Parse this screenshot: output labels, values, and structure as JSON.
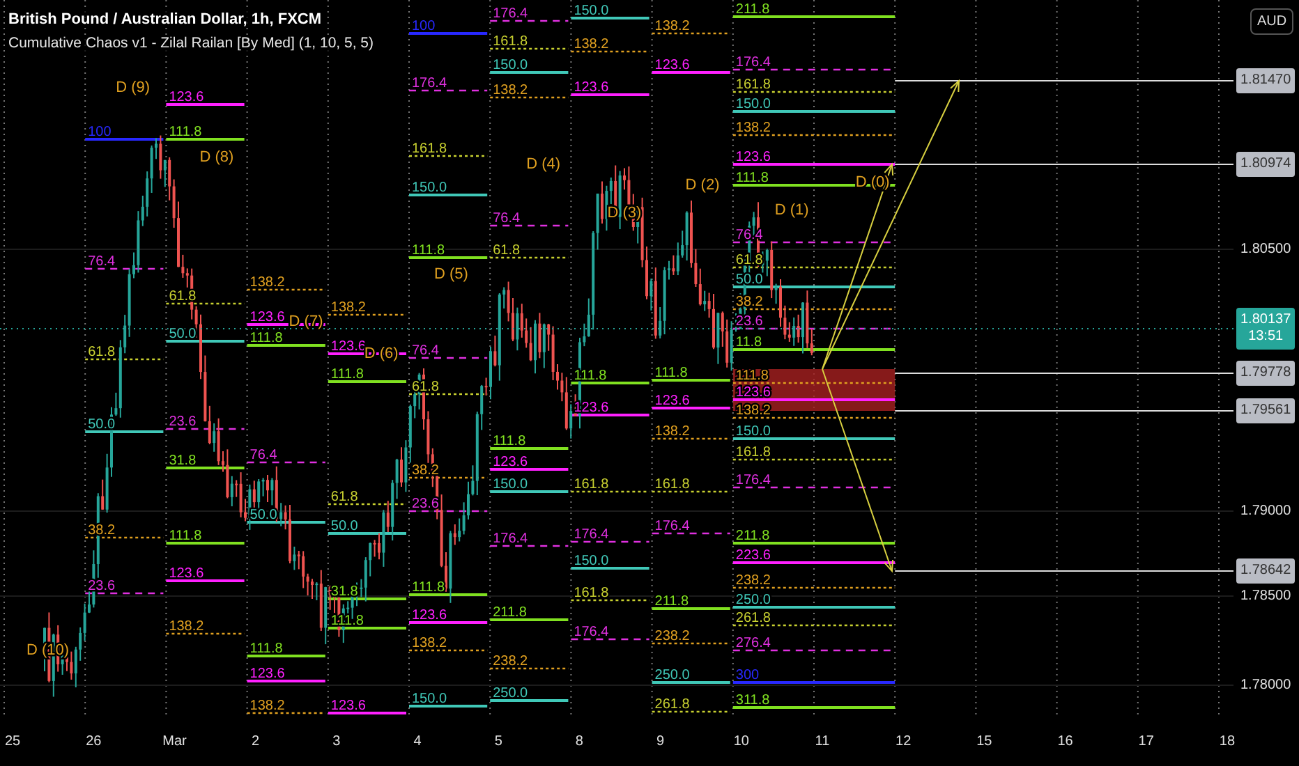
{
  "legend": {
    "title": "British Pound / Australian Dollar, 1h, FXCM",
    "indicator": "Cumulative Chaos v1 - Zilal Railan [By Med] (1, 10, 5, 5)"
  },
  "currency": "AUD",
  "fib_columns": [
    {
      "waves": [
        {
          "label": "D (10)"
        }
      ]
    },
    {
      "levels": [
        {
          "label": "100",
          "color": "#2828ff",
          "kind": "solid"
        },
        {
          "label": "76.4",
          "color": "#e030e0",
          "kind": "dashed"
        },
        {
          "label": "61.8",
          "color": "#c8d030",
          "kind": "dotted"
        },
        {
          "label": "50.0",
          "color": "#40c8b8",
          "kind": "solid"
        },
        {
          "label": "38.2",
          "color": "#e0a020",
          "kind": "dotted"
        },
        {
          "label": "23.6",
          "color": "#e030e0",
          "kind": "dashed"
        }
      ],
      "waves": [
        {
          "label": "D (9)"
        }
      ]
    },
    {
      "levels": [
        {
          "label": "123.6",
          "color": "#ff20ff",
          "kind": "solid"
        },
        {
          "label": "111.8",
          "color": "#80e020",
          "kind": "solid"
        },
        {
          "label": "61.8",
          "color": "#c8d030",
          "kind": "dotted"
        },
        {
          "label": "50.0",
          "color": "#40c8b8",
          "kind": "solid"
        },
        {
          "label": "23.6",
          "color": "#e030e0",
          "kind": "dashed"
        },
        {
          "label": "31.8",
          "color": "#80e020",
          "kind": "solid"
        },
        {
          "label": "111.8",
          "color": "#80e020",
          "kind": "solid"
        },
        {
          "label": "123.6",
          "color": "#ff20ff",
          "kind": "solid"
        },
        {
          "label": "138.2",
          "color": "#e0a020",
          "kind": "dotted"
        }
      ],
      "waves": [
        {
          "label": "D (8)"
        }
      ]
    },
    {
      "levels": [
        {
          "label": "138.2",
          "color": "#e0a020",
          "kind": "dotted"
        },
        {
          "label": "123.6",
          "color": "#ff20ff",
          "kind": "solid"
        },
        {
          "label": "111.8",
          "color": "#80e020",
          "kind": "solid"
        },
        {
          "label": "76.4",
          "color": "#e030e0",
          "kind": "dashed"
        },
        {
          "label": "50.0",
          "color": "#40c8b8",
          "kind": "solid"
        },
        {
          "label": "111.8",
          "color": "#80e020",
          "kind": "solid"
        },
        {
          "label": "123.6",
          "color": "#ff20ff",
          "kind": "solid"
        },
        {
          "label": "138.2",
          "color": "#e0a020",
          "kind": "dotted"
        }
      ],
      "waves": [
        {
          "label": "D (7)"
        }
      ]
    },
    {
      "levels": [
        {
          "label": "138.2",
          "color": "#e0a020",
          "kind": "dotted"
        },
        {
          "label": "123.6",
          "color": "#ff20ff",
          "kind": "solid"
        },
        {
          "label": "111.8",
          "color": "#80e020",
          "kind": "solid"
        },
        {
          "label": "61.8",
          "color": "#c8d030",
          "kind": "dotted"
        },
        {
          "label": "50.0",
          "color": "#40c8b8",
          "kind": "solid"
        },
        {
          "label": "31.8",
          "color": "#80e020",
          "kind": "solid"
        },
        {
          "label": "111.8",
          "color": "#80e020",
          "kind": "solid"
        },
        {
          "label": "123.6",
          "color": "#ff20ff",
          "kind": "solid"
        }
      ],
      "waves": [
        {
          "label": "D (6)"
        }
      ]
    },
    {
      "levels": [
        {
          "label": "100",
          "color": "#2828ff",
          "kind": "solid"
        },
        {
          "label": "176.4",
          "color": "#e030e0",
          "kind": "dashed"
        },
        {
          "label": "161.8",
          "color": "#c8d030",
          "kind": "dotted"
        },
        {
          "label": "150.0",
          "color": "#40c8b8",
          "kind": "solid"
        },
        {
          "label": "111.8",
          "color": "#80e020",
          "kind": "solid"
        },
        {
          "label": "76.4",
          "color": "#e030e0",
          "kind": "dashed"
        },
        {
          "label": "61.8",
          "color": "#c8d030",
          "kind": "dotted"
        },
        {
          "label": "38.2",
          "color": "#e0a020",
          "kind": "dotted"
        },
        {
          "label": "23.6",
          "color": "#e030e0",
          "kind": "dashed"
        },
        {
          "label": "111.8",
          "color": "#80e020",
          "kind": "solid"
        },
        {
          "label": "123.6",
          "color": "#ff20ff",
          "kind": "solid"
        },
        {
          "label": "138.2",
          "color": "#e0a020",
          "kind": "dotted"
        },
        {
          "label": "150.0",
          "color": "#40c8b8",
          "kind": "solid"
        }
      ],
      "waves": [
        {
          "label": "D (5)"
        }
      ]
    },
    {
      "levels": [
        {
          "label": "176.4",
          "color": "#e030e0",
          "kind": "dashed"
        },
        {
          "label": "161.8",
          "color": "#c8d030",
          "kind": "dotted"
        },
        {
          "label": "150.0",
          "color": "#40c8b8",
          "kind": "solid"
        },
        {
          "label": "138.2",
          "color": "#e0a020",
          "kind": "dotted"
        },
        {
          "label": "76.4",
          "color": "#e030e0",
          "kind": "dashed"
        },
        {
          "label": "61.8",
          "color": "#c8d030",
          "kind": "dotted"
        },
        {
          "label": "111.8",
          "color": "#80e020",
          "kind": "solid"
        },
        {
          "label": "123.6",
          "color": "#ff20ff",
          "kind": "solid"
        },
        {
          "label": "150.0",
          "color": "#40c8b8",
          "kind": "solid"
        },
        {
          "label": "176.4",
          "color": "#e030e0",
          "kind": "dashed"
        },
        {
          "label": "211.8",
          "color": "#80e020",
          "kind": "solid"
        },
        {
          "label": "238.2",
          "color": "#e0a020",
          "kind": "dotted"
        },
        {
          "label": "250.0",
          "color": "#40c8b8",
          "kind": "solid"
        }
      ],
      "waves": [
        {
          "label": "D (4)"
        }
      ]
    },
    {
      "levels": [
        {
          "label": "150.0",
          "color": "#40c8b8",
          "kind": "solid"
        },
        {
          "label": "138.2",
          "color": "#e0a020",
          "kind": "dotted"
        },
        {
          "label": "123.6",
          "color": "#ff20ff",
          "kind": "solid"
        },
        {
          "label": "111.8",
          "color": "#80e020",
          "kind": "solid"
        },
        {
          "label": "123.6",
          "color": "#ff20ff",
          "kind": "solid"
        },
        {
          "label": "161.8",
          "color": "#c8d030",
          "kind": "dotted"
        },
        {
          "label": "176.4",
          "color": "#e030e0",
          "kind": "dashed"
        },
        {
          "label": "150.0",
          "color": "#40c8b8",
          "kind": "solid"
        },
        {
          "label": "161.8",
          "color": "#c8d030",
          "kind": "dotted"
        },
        {
          "label": "176.4",
          "color": "#e030e0",
          "kind": "dashed"
        }
      ],
      "waves": [
        {
          "label": "D (3)"
        }
      ]
    },
    {
      "levels": [
        {
          "label": "138.2",
          "color": "#e0a020",
          "kind": "dotted"
        },
        {
          "label": "123.6",
          "color": "#ff20ff",
          "kind": "solid"
        },
        {
          "label": "111.8",
          "color": "#80e020",
          "kind": "solid"
        },
        {
          "label": "123.6",
          "color": "#ff20ff",
          "kind": "solid"
        },
        {
          "label": "138.2",
          "color": "#e0a020",
          "kind": "dotted"
        },
        {
          "label": "161.8",
          "color": "#c8d030",
          "kind": "dotted"
        },
        {
          "label": "176.4",
          "color": "#e030e0",
          "kind": "dashed"
        },
        {
          "label": "211.8",
          "color": "#80e020",
          "kind": "solid"
        },
        {
          "label": "238.2",
          "color": "#e0a020",
          "kind": "dotted"
        },
        {
          "label": "250.0",
          "color": "#40c8b8",
          "kind": "solid"
        },
        {
          "label": "261.8",
          "color": "#c8d030",
          "kind": "dotted"
        }
      ],
      "waves": [
        {
          "label": "D (2)"
        }
      ]
    },
    {
      "levels": [
        {
          "label": "211.8",
          "color": "#80e020",
          "kind": "solid"
        },
        {
          "label": "176.4",
          "color": "#e030e0",
          "kind": "dashed"
        },
        {
          "label": "161.8",
          "color": "#c8d030",
          "kind": "dotted"
        },
        {
          "label": "150.0",
          "color": "#40c8b8",
          "kind": "solid"
        },
        {
          "label": "138.2",
          "color": "#e0a020",
          "kind": "dotted"
        },
        {
          "label": "123.6",
          "color": "#ff20ff",
          "kind": "solid"
        },
        {
          "label": "111.8",
          "color": "#80e020",
          "kind": "solid"
        },
        {
          "label": "76.4",
          "color": "#e030e0",
          "kind": "dashed"
        },
        {
          "label": "61.8",
          "color": "#c8d030",
          "kind": "dotted"
        },
        {
          "label": "50.0",
          "color": "#40c8b8",
          "kind": "solid"
        },
        {
          "label": "38.2",
          "color": "#e0a020",
          "kind": "dotted"
        },
        {
          "label": "23.6",
          "color": "#e030e0",
          "kind": "dashed"
        },
        {
          "label": "11.8",
          "color": "#80e020",
          "kind": "solid"
        },
        {
          "label": "111.8",
          "color": "#e0a020",
          "kind": "dotted"
        },
        {
          "label": "123.6",
          "color": "#ff20ff",
          "kind": "solid"
        },
        {
          "label": "138.2",
          "color": "#e0a020",
          "kind": "dotted"
        },
        {
          "label": "150.0",
          "color": "#40c8b8",
          "kind": "solid"
        },
        {
          "label": "161.8",
          "color": "#c8d030",
          "kind": "dotted"
        },
        {
          "label": "176.4",
          "color": "#e030e0",
          "kind": "dashed"
        },
        {
          "label": "211.8",
          "color": "#80e020",
          "kind": "solid"
        },
        {
          "label": "223.6",
          "color": "#ff20ff",
          "kind": "solid"
        },
        {
          "label": "238.2",
          "color": "#e0a020",
          "kind": "dotted"
        },
        {
          "label": "250.0",
          "color": "#40c8b8",
          "kind": "solid"
        },
        {
          "label": "261.8",
          "color": "#c8d030",
          "kind": "dotted"
        },
        {
          "label": "276.4",
          "color": "#e030e0",
          "kind": "dashed"
        },
        {
          "label": "300",
          "color": "#2828ff",
          "kind": "solid"
        },
        {
          "label": "311.8",
          "color": "#80e020",
          "kind": "solid"
        }
      ],
      "waves": [
        {
          "label": "D (1)"
        },
        {
          "label": "D (0)"
        }
      ]
    }
  ],
  "price_tags": [
    "1.81470",
    "1.80974",
    "1.79778",
    "1.79561",
    "1.78642"
  ],
  "current_price": {
    "price": "1.80137",
    "countdown": "13:51"
  },
  "price_axis": [
    "1.80500",
    "1.79000",
    "1.78500",
    "1.78000"
  ],
  "dates": [
    "25",
    "26",
    "Mar",
    "2",
    "3",
    "4",
    "5",
    "8",
    "9",
    "10",
    "11",
    "12",
    "15",
    "16",
    "17",
    "18"
  ]
}
